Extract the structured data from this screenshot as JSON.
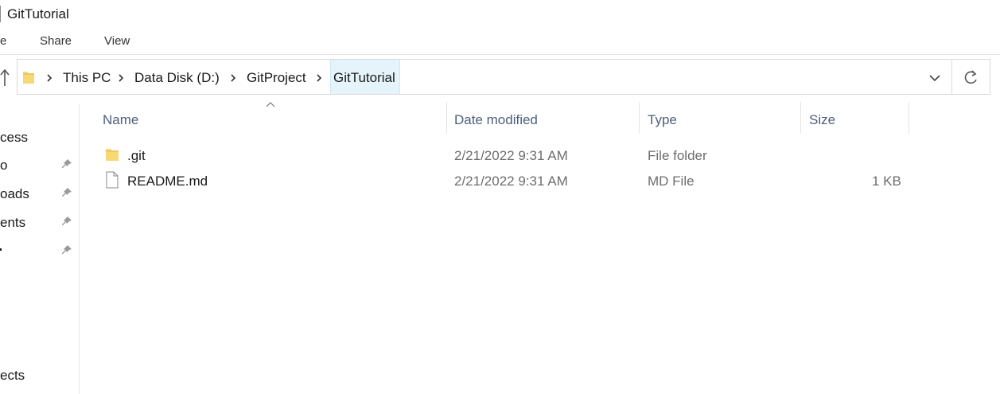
{
  "window": {
    "title": "GitTutorial"
  },
  "ribbon": {
    "tabs": [
      "e",
      "Share",
      "View"
    ]
  },
  "address": {
    "crumbs": [
      "This PC",
      "Data Disk (D:)",
      "GitProject",
      "GitTutorial"
    ]
  },
  "nav": {
    "items": [
      "cess",
      "o",
      "oads",
      "ents",
      "",
      "ects"
    ]
  },
  "columns": {
    "name": "Name",
    "date": "Date modified",
    "type": "Type",
    "size": "Size"
  },
  "files": [
    {
      "name": ".git",
      "date": "2/21/2022 9:31 AM",
      "type": "File folder",
      "size": "",
      "icon": "folder-icon"
    },
    {
      "name": "README.md",
      "date": "2/21/2022 9:31 AM",
      "type": "MD File",
      "size": "1 KB",
      "icon": "document-icon"
    }
  ],
  "colors": {
    "folder": "#f8d775",
    "selected_crumb": "#e5f3fb",
    "header_text": "#4c607a"
  }
}
